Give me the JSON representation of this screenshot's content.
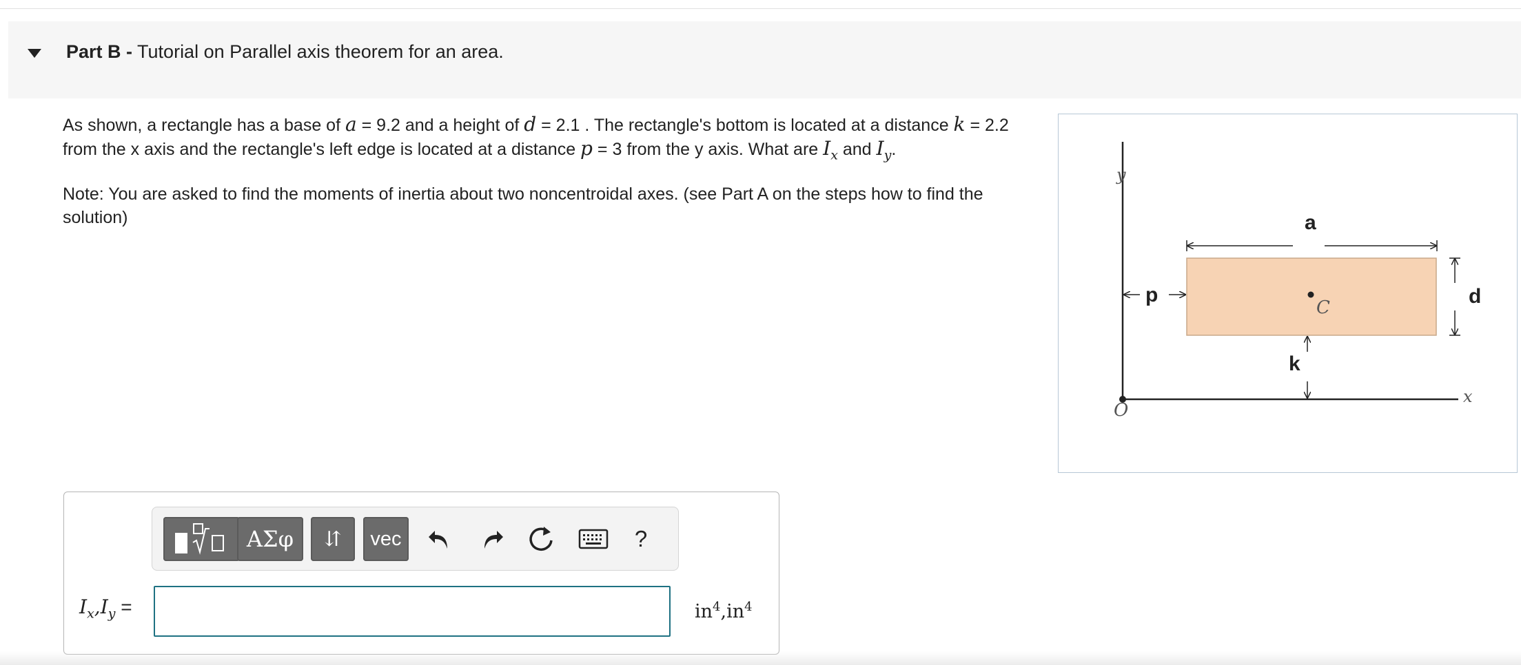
{
  "part": {
    "label": "Part B -",
    "title": "Tutorial on Parallel axis theorem for an area."
  },
  "problem": {
    "p1_text1": "As shown, a rectangle has a base of ",
    "var_a": "a",
    "p1_text2": " = 9.2 and a height of ",
    "var_d": "d",
    "p1_text3": " = 2.1 . The rectangle's bottom is located at a distance ",
    "var_k": "k",
    "p1_text4": " = 2.2 from the x axis and the  rectangle's left edge is located at a distance ",
    "var_p": "p",
    "p1_text5": " = 3 from the y axis. What are ",
    "var_I": "I",
    "sub_x": "x",
    "p1_text6": " and ",
    "sub_y": "y",
    "p1_text7": ".",
    "note": "Note: You are asked to find the moments of inertia about two noncentroidal axes. (see Part A on the steps how to find the solution)"
  },
  "figure": {
    "label_y": "y",
    "label_x": "x",
    "label_o": "O",
    "label_a": "a",
    "label_d": "d",
    "label_p": "p",
    "label_k": "k",
    "label_c": "C",
    "rect_fill": "#f7d3b4",
    "rect_stroke": "#c9a88a"
  },
  "toolbar": {
    "templates_icon": "fraction-sqrt-icon",
    "greek_label": "ΑΣφ",
    "arrows_label": "⇵",
    "vec_label": "vec",
    "undo_icon": "undo-icon",
    "redo_icon": "redo-icon",
    "reset_icon": "reset-icon",
    "keyboard_icon": "keyboard-icon",
    "help_label": "?"
  },
  "answer": {
    "label_I1": "I",
    "label_sub1": "x",
    "label_comma": ",",
    "label_I2": "I",
    "label_sub2": "y",
    "label_eq": " =",
    "value": "",
    "units_base1": "in",
    "units_exp1": "4",
    "units_sep": ",",
    "units_base2": "in",
    "units_exp2": "4"
  },
  "colors": {
    "accent": "#1e7182",
    "button": "#6b6b6b",
    "header_bg": "#f6f6f6"
  }
}
